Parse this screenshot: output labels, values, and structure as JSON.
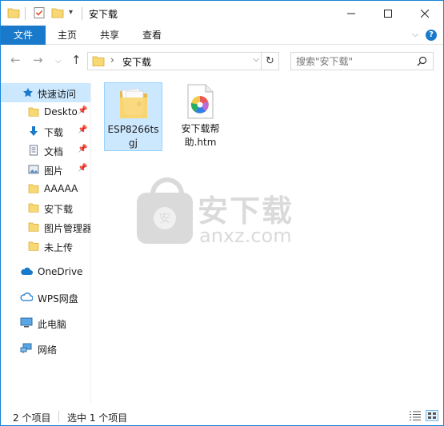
{
  "titlebar": {
    "title": "安下载",
    "icons": [
      "folder-icon",
      "properties-check-icon",
      "new-folder-icon",
      "customize-dropdown-icon"
    ]
  },
  "ribbon": {
    "tabs": [
      {
        "label": "文件",
        "name": "tab-file"
      },
      {
        "label": "主页",
        "name": "tab-home"
      },
      {
        "label": "共享",
        "name": "tab-share"
      },
      {
        "label": "查看",
        "name": "tab-view"
      }
    ],
    "help": "?"
  },
  "address": {
    "crumb": "安下载"
  },
  "search": {
    "placeholder": "搜索\"安下载\""
  },
  "sidebar": {
    "items": [
      {
        "label": "快速访问",
        "icon": "star-icon",
        "pinned": false,
        "active": true
      },
      {
        "label": "Deskto",
        "icon": "folder-icon",
        "pinned": true
      },
      {
        "label": "下载",
        "icon": "download-arrow-icon",
        "pinned": true
      },
      {
        "label": "文档",
        "icon": "document-icon",
        "pinned": true
      },
      {
        "label": "图片",
        "icon": "pictures-icon",
        "pinned": true
      },
      {
        "label": "AAAAA",
        "icon": "folder-icon",
        "pinned": false
      },
      {
        "label": "安下载",
        "icon": "folder-icon",
        "pinned": false
      },
      {
        "label": "图片管理器",
        "icon": "folder-icon",
        "pinned": false
      },
      {
        "label": "未上传",
        "icon": "folder-icon",
        "pinned": false
      },
      {
        "label": "OneDrive",
        "icon": "cloud-icon",
        "pinned": false
      },
      {
        "label": "WPS网盘",
        "icon": "wps-cloud-icon",
        "pinned": false
      },
      {
        "label": "此电脑",
        "icon": "computer-icon",
        "pinned": false
      },
      {
        "label": "网络",
        "icon": "network-icon",
        "pinned": false
      }
    ]
  },
  "files": [
    {
      "label_line1": "ESP8266ts",
      "label_line2": "gj",
      "icon": "folder-icon",
      "selected": true
    },
    {
      "label_line1": "安下载帮",
      "label_line2": "助.htm",
      "icon": "htm-file-icon",
      "selected": false
    }
  ],
  "watermark": {
    "text_cn": "安下载",
    "text_en": "anxz.com"
  },
  "status": {
    "item_count": "2 个项目",
    "selected_count": "选中 1 个项目"
  },
  "colors": {
    "accent": "#1979ca",
    "selection": "#cce8ff",
    "folder": "#f8d775"
  }
}
